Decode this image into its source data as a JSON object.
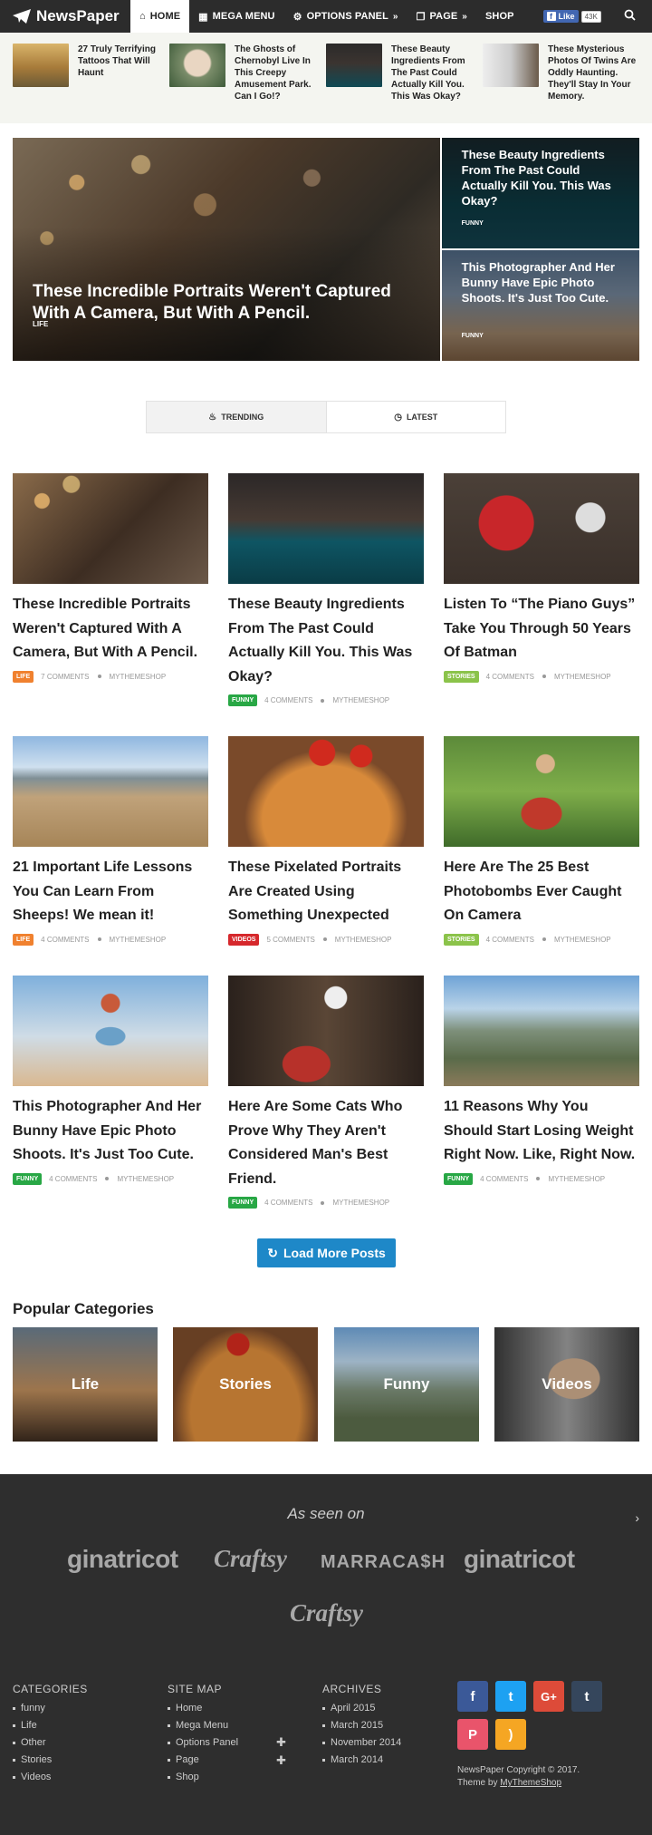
{
  "header": {
    "logo": "NewsPaper",
    "nav": [
      {
        "label": "HOME",
        "icon": "home-icon"
      },
      {
        "label": "MEGA MENU",
        "icon": "grid-icon"
      },
      {
        "label": "OPTIONS PANEL",
        "icon": "gear-icon"
      },
      {
        "label": "PAGE",
        "icon": "copy-icon"
      },
      {
        "label": "SHOP"
      }
    ],
    "fb_like": "Like",
    "fb_count": "43K"
  },
  "strip": [
    {
      "title": "27 Truly Terrifying Tattoos That Will Haunt"
    },
    {
      "title": "The Ghosts of Chernobyl Live In This Creepy Amusement Park. Can I Go!?"
    },
    {
      "title": "These Beauty Ingredients From The Past Could Actually Kill You. This Was Okay?"
    },
    {
      "title": "These Mysterious Photos Of Twins Are Oddly Haunting. They'll Stay In Your Memory."
    }
  ],
  "hero": {
    "main": {
      "title": "These Incredible Portraits Weren't Captured With A Camera, But With A Pencil.",
      "category": "LIFE"
    },
    "side": [
      {
        "title": "These Beauty Ingredients From The Past Could Actually Kill You. This Was Okay?",
        "category": "FUNNY"
      },
      {
        "title": "This Photographer And Her Bunny Have Epic Photo Shoots. It's Just Too Cute.",
        "category": "FUNNY"
      }
    ]
  },
  "tabs": {
    "trending": "TRENDING",
    "latest": "LATEST"
  },
  "posts": [
    {
      "title": "These Incredible Portraits Weren't Captured With A Camera, But With A Pencil.",
      "category": "LIFE",
      "color": "#f0812f",
      "comments": "7 COMMENTS",
      "author": "MYTHEMESHOP"
    },
    {
      "title": "These Beauty Ingredients From The Past Could Actually Kill You. This Was Okay?",
      "category": "FUNNY",
      "color": "#28a745",
      "comments": "4 COMMENTS",
      "author": "MYTHEMESHOP"
    },
    {
      "title": "Listen To “The Piano Guys” Take You Through 50 Years Of Batman",
      "category": "STORIES",
      "color": "#8bc34a",
      "comments": "4 COMMENTS",
      "author": "MYTHEMESHOP"
    },
    {
      "title": "21 Important Life Lessons You Can Learn From Sheeps! We mean it!",
      "category": "LIFE",
      "color": "#f0812f",
      "comments": "4 COMMENTS",
      "author": "MYTHEMESHOP"
    },
    {
      "title": "These Pixelated Portraits Are Created Using Something Unexpected",
      "category": "VIDEOS",
      "color": "#d6282c",
      "comments": "5 COMMENTS",
      "author": "MYTHEMESHOP"
    },
    {
      "title": "Here Are The 25 Best Photobombs Ever Caught On Camera",
      "category": "STORIES",
      "color": "#8bc34a",
      "comments": "4 COMMENTS",
      "author": "MYTHEMESHOP"
    },
    {
      "title": "This Photographer And Her Bunny Have Epic Photo Shoots. It's Just Too Cute.",
      "category": "FUNNY",
      "color": "#28a745",
      "comments": "4 COMMENTS",
      "author": "MYTHEMESHOP"
    },
    {
      "title": "Here Are Some Cats Who Prove Why They Aren't Considered Man's Best Friend.",
      "category": "FUNNY",
      "color": "#28a745",
      "comments": "4 COMMENTS",
      "author": "MYTHEMESHOP"
    },
    {
      "title": "11 Reasons Why You Should Start Losing Weight Right Now. Like, Right Now.",
      "category": "FUNNY",
      "color": "#28a745",
      "comments": "4 COMMENTS",
      "author": "MYTHEMESHOP"
    }
  ],
  "load_more": "Load More Posts",
  "popular": {
    "title": "Popular Categories",
    "items": [
      "Life",
      "Stories",
      "Funny",
      "Videos"
    ]
  },
  "footer": {
    "seen_on": "As seen on",
    "brands": [
      "ginatricot",
      "Craftsy",
      "MARRACA$H",
      "ginatricot",
      "Craftsy"
    ],
    "columns": {
      "categories": {
        "title": "CATEGORIES",
        "items": [
          "funny",
          "Life",
          "Other",
          "Stories",
          "Videos"
        ]
      },
      "sitemap": {
        "title": "SITE MAP",
        "items": [
          "Home",
          "Mega Menu",
          "Options Panel",
          "Page",
          "Shop"
        ]
      },
      "archives": {
        "title": "ARCHIVES",
        "items": [
          "April 2015",
          "March 2015",
          "November 2014",
          "March 2014"
        ]
      }
    },
    "social": [
      {
        "name": "facebook-icon",
        "glyph": "f",
        "color": "#3b5998"
      },
      {
        "name": "twitter-icon",
        "glyph": "t",
        "color": "#1da1f2"
      },
      {
        "name": "google-plus-icon",
        "glyph": "G+",
        "color": "#dd4b39"
      },
      {
        "name": "tumblr-icon",
        "glyph": "t",
        "color": "#35465c"
      },
      {
        "name": "pinterest-icon",
        "glyph": "P",
        "color": "#e9546b"
      },
      {
        "name": "rss-icon",
        "glyph": ")",
        "color": "#f5a623"
      }
    ],
    "copyright": "NewsPaper Copyright © 2017.",
    "theme_by_prefix": "Theme by",
    "theme_by_link": "MyThemeShop"
  }
}
